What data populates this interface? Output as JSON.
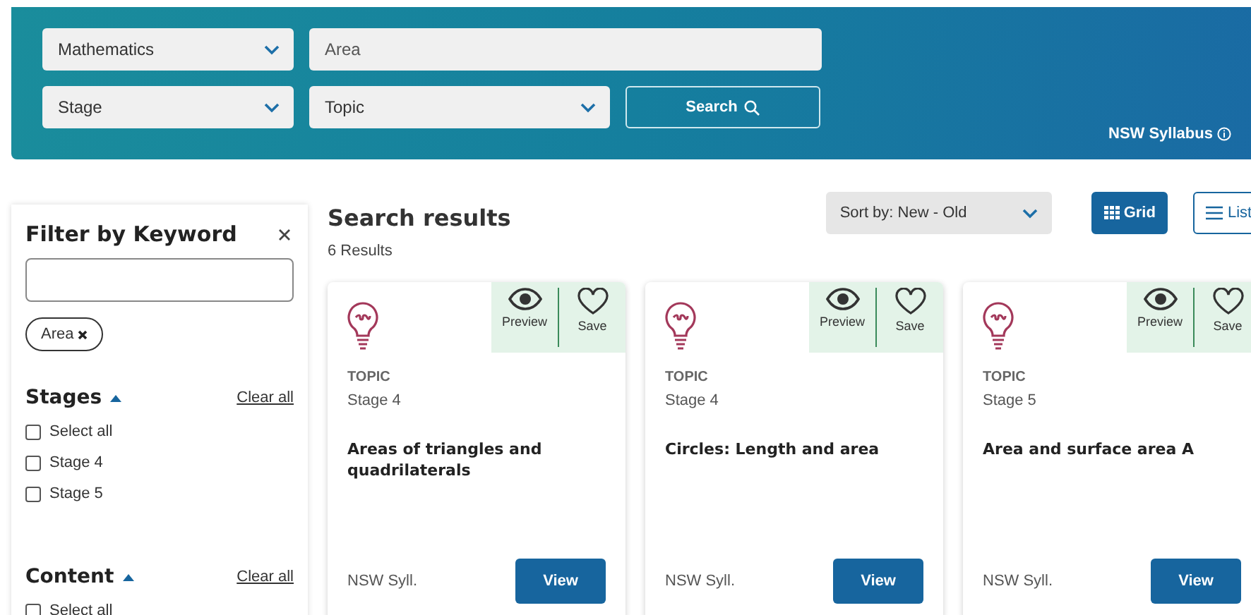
{
  "search_bar": {
    "subject": "Mathematics",
    "keyword": "Area",
    "stage": "Stage",
    "type": "Topic",
    "button": "Search",
    "syllabus_link": "NSW Syllabus"
  },
  "filters": {
    "title": "Filter by Keyword",
    "chips": [
      "Area"
    ],
    "sections": [
      {
        "title": "Stages",
        "expanded": true,
        "clear": "Clear all",
        "options": [
          {
            "label": "Select all",
            "checked": false
          },
          {
            "label": "Stage 4",
            "checked": false
          },
          {
            "label": "Stage 5",
            "checked": false
          }
        ]
      },
      {
        "title": "Content",
        "expanded": true,
        "clear": "Clear all",
        "options": [
          {
            "label": "Select all",
            "checked": false
          }
        ]
      }
    ]
  },
  "results": {
    "title": "Search results",
    "count": "6 Results",
    "sort": "Sort by: New - Old",
    "views": [
      {
        "label": "Grid",
        "kind": "grid",
        "selected": true
      },
      {
        "label": "List",
        "kind": "list",
        "selected": false
      }
    ],
    "cards": [
      {
        "type": "TOPIC",
        "stage": "Stage 4",
        "title": "Areas of triangles and quadrilaterals",
        "source": "NSW Syll.",
        "preview": "Preview",
        "save": "Save",
        "button": "View"
      },
      {
        "type": "TOPIC",
        "stage": "Stage 4",
        "title": "Circles: Length and area",
        "source": "NSW Syll.",
        "preview": "Preview",
        "save": "Save",
        "button": "View"
      },
      {
        "type": "TOPIC",
        "stage": "Stage 5",
        "title": "Area and surface area A",
        "source": "NSW Syll.",
        "preview": "Preview",
        "save": "Save",
        "button": "View"
      }
    ]
  }
}
